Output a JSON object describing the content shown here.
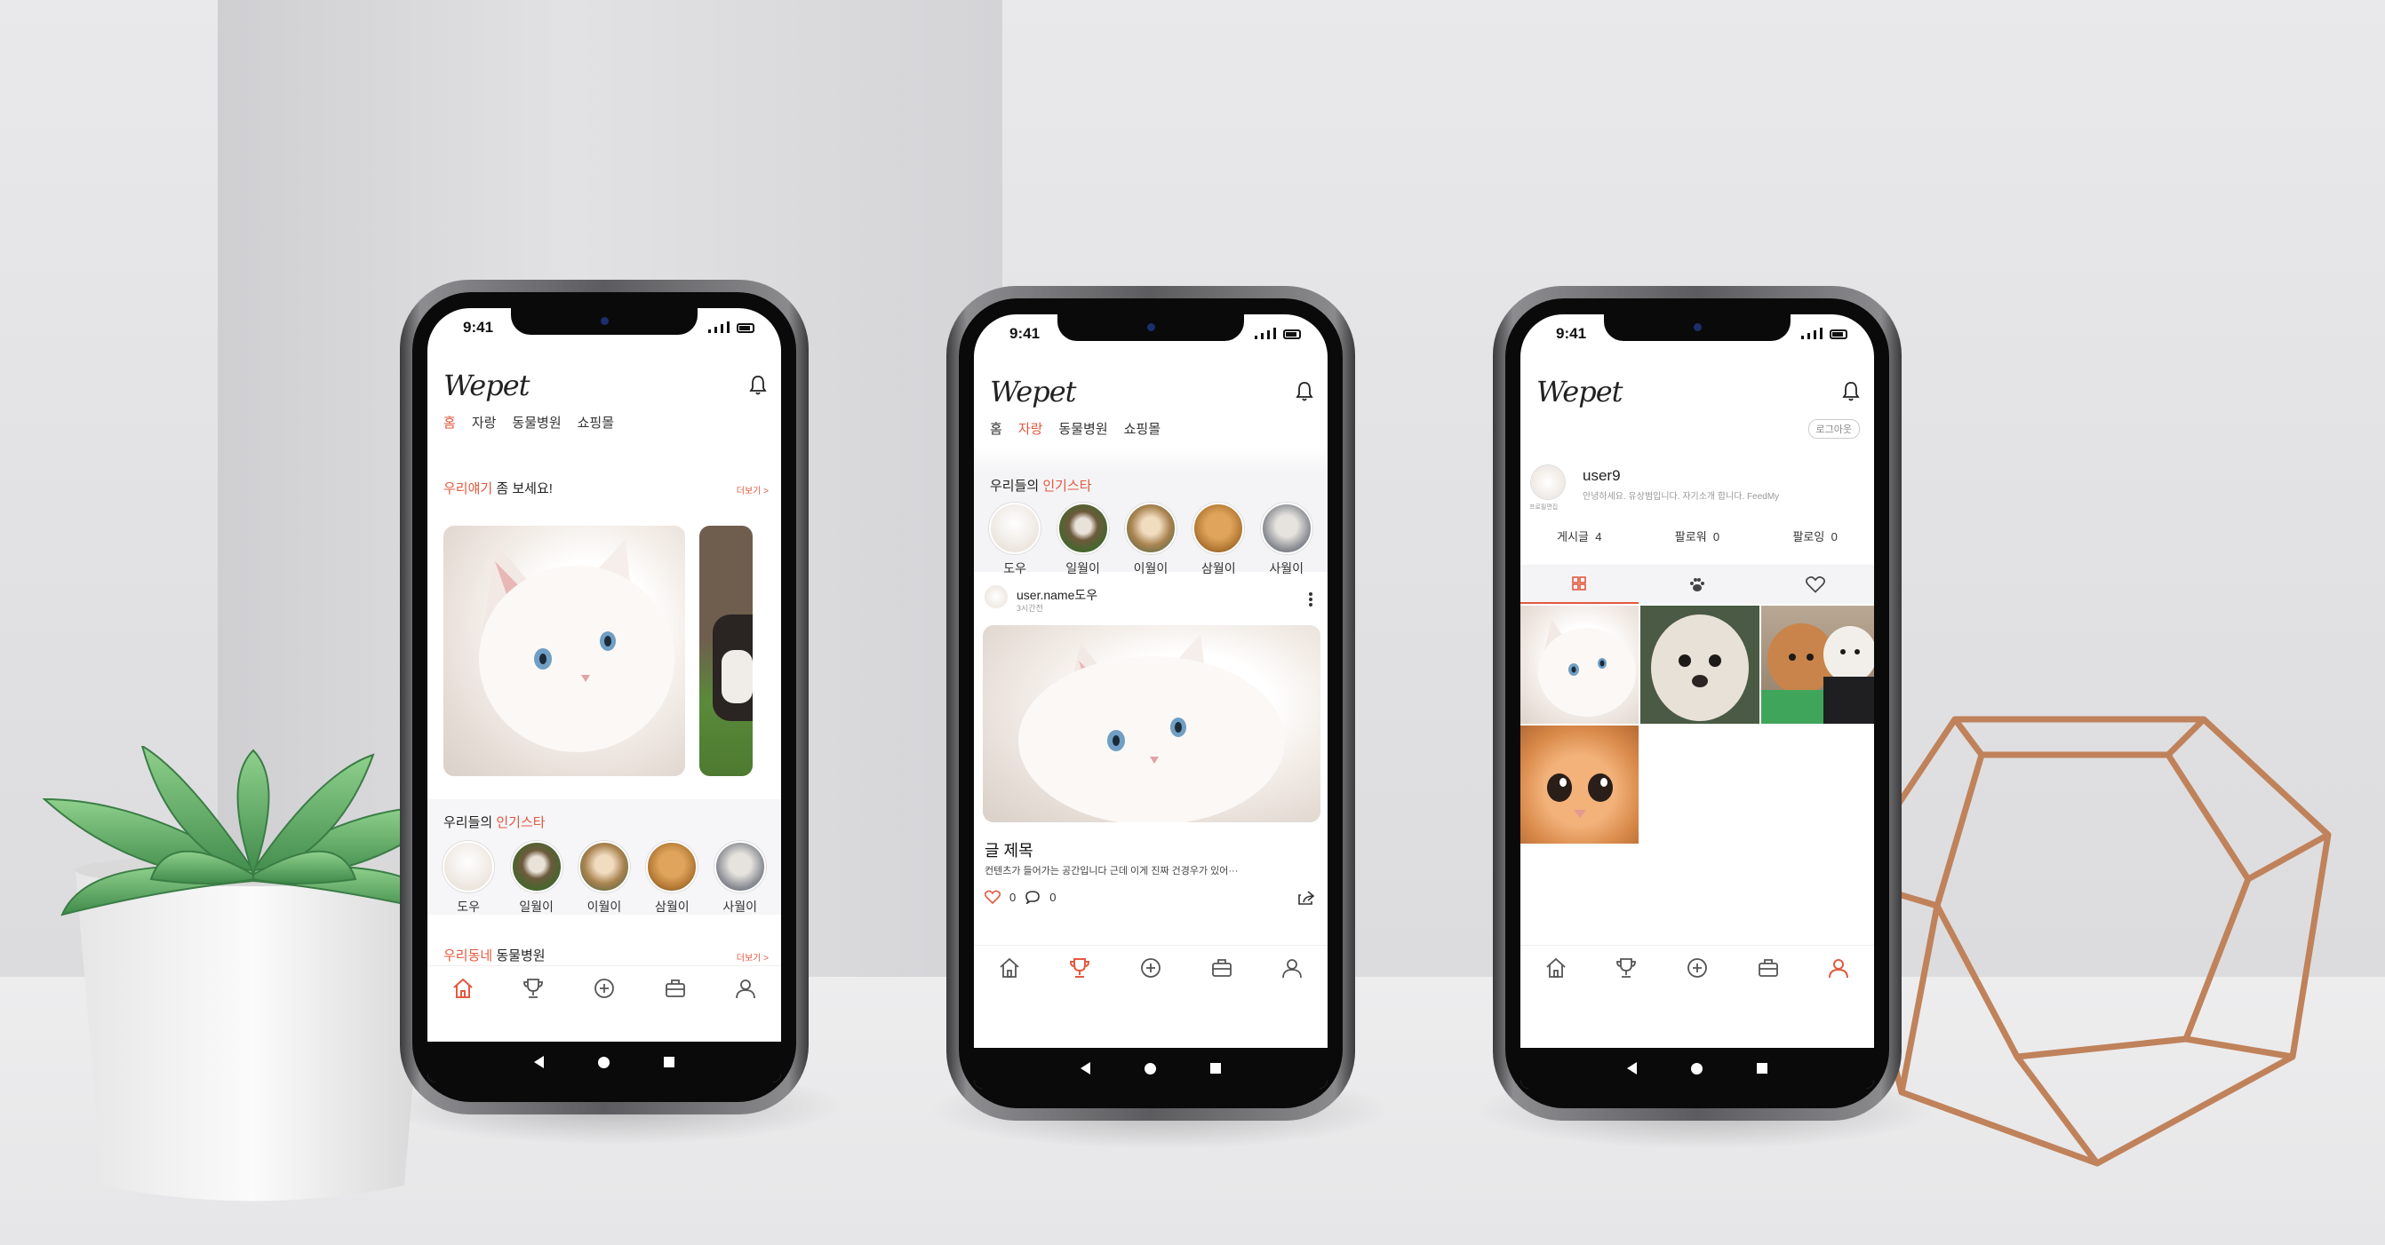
{
  "app": {
    "logo": "Wepet",
    "time": "9:41"
  },
  "colors": {
    "accent": "#e2593f",
    "background": "#e4e4e6"
  },
  "tabs": [
    "홈",
    "자랑",
    "동물병원",
    "쇼핑몰"
  ],
  "home": {
    "section1": {
      "prefix": "우리얘기",
      "suffix": "좀 보세요!",
      "more": "더보기 >"
    },
    "section2": {
      "prefix": "우리들의",
      "accent": "인기스타"
    },
    "section3": {
      "prefix": "우리동네",
      "suffix": "동물병원",
      "more": "더보기 >"
    }
  },
  "stars": [
    {
      "name": "도우",
      "color": "#ede6df"
    },
    {
      "name": "일월이",
      "color": "#6d5a3c"
    },
    {
      "name": "이월이",
      "color": "#a9834f"
    },
    {
      "name": "삼월이",
      "color": "#b57b36"
    },
    {
      "name": "사월이",
      "color": "#8c8f95"
    }
  ],
  "feed": {
    "section": {
      "prefix": "우리들의",
      "accent": "인기스타"
    },
    "post": {
      "username": "user.name도우",
      "time": "3시간전",
      "title": "글 제목",
      "body": "컨텐츠가 들어가는 공간입니다 근데 이게 진짜 건경우가 있어···",
      "likes": "0",
      "comments": "0"
    }
  },
  "profile": {
    "logout": "로그아웃",
    "username": "user9",
    "edit_label": "프로필편집",
    "bio": "안녕하세요. 유상범입니다. 자기소개 합니다. FeedMy",
    "stats": [
      {
        "label": "게시글",
        "value": "4"
      },
      {
        "label": "팔로워",
        "value": "0"
      },
      {
        "label": "팔로잉",
        "value": "0"
      }
    ],
    "grid": [
      "white-cat",
      "maltese",
      "poodles",
      "orange-kitten"
    ]
  },
  "nav": [
    "home-icon",
    "trophy-icon",
    "plus-circle-icon",
    "briefcase-icon",
    "user-icon"
  ]
}
